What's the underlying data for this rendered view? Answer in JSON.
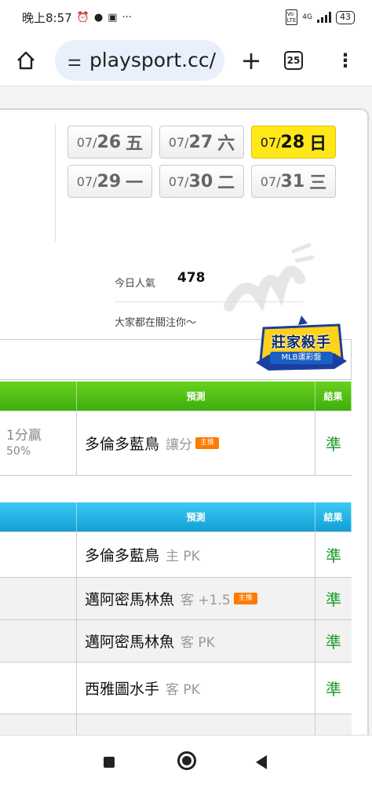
{
  "status": {
    "time": "晚上8:57",
    "left_icons": [
      "alarm-icon",
      "chat-icon",
      "youtube-icon",
      "more-dots-icon"
    ],
    "signal": "4G",
    "battery": "43"
  },
  "browser": {
    "url": "playsport.cc/",
    "tab_count": "25",
    "plus": "+",
    "menu": "⋮"
  },
  "dates": [
    {
      "md": "07/",
      "d": "26",
      "wd": "五",
      "active": false
    },
    {
      "md": "07/",
      "d": "27",
      "wd": "六",
      "active": false
    },
    {
      "md": "07/",
      "d": "28",
      "wd": "日",
      "active": true
    },
    {
      "md": "07/",
      "d": "29",
      "wd": "一",
      "active": false
    },
    {
      "md": "07/",
      "d": "30",
      "wd": "二",
      "active": false
    },
    {
      "md": "07/",
      "d": "31",
      "wd": "三",
      "active": false
    }
  ],
  "popularity": {
    "label": "今日人氣",
    "value": "478",
    "subtitle": "大家都在關注你～"
  },
  "badge": {
    "title": "莊家殺手",
    "subtitle": "MLB運彩盤"
  },
  "table1": {
    "header": {
      "prediction": "預測",
      "result": "結果"
    },
    "rows": [
      {
        "left_line1": "1分贏",
        "left_line2": "50%",
        "team": "多倫多藍鳥",
        "extra": "讓分",
        "tag": "主推",
        "result": "準"
      }
    ]
  },
  "table2": {
    "header": {
      "prediction": "預測",
      "result": "結果"
    },
    "rows": [
      {
        "team": "多倫多藍鳥",
        "extra": "主 PK",
        "result": "準"
      },
      {
        "team": "邁阿密馬林魚",
        "extra": "客 +1.5",
        "tag": "主推",
        "result": "準"
      },
      {
        "team": "邁阿密馬林魚",
        "extra": "客 PK",
        "result": "準"
      },
      {
        "team": "西雅圖水手",
        "extra": "客 PK",
        "result": "準"
      }
    ]
  },
  "colors": {
    "active_date": "#ffe81a",
    "green_header": "#3fae0d",
    "blue_header": "#119fd6",
    "result_green": "#1a9a2a",
    "tag_orange": "#ff7a00"
  }
}
